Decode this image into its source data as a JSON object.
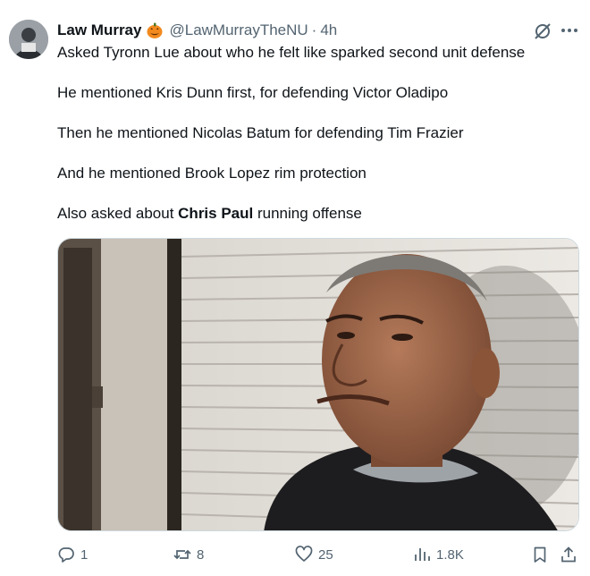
{
  "author": {
    "name": "Law Murray",
    "emoji_icon": "jack-o-lantern-icon",
    "handle": "@LawMurrayTheNU",
    "separator": "·",
    "time": "4h"
  },
  "tweet": {
    "lines": [
      "Asked Tyronn Lue about who he felt like sparked second unit defense",
      "He mentioned Kris Dunn first, for defending Victor Oladipo",
      "Then he mentioned Nicolas Batum for defending Tim Frazier",
      "And he mentioned Brook Lopez rim protection"
    ],
    "last_line_pre": "Also asked about ",
    "last_line_bold": "Chris Paul",
    "last_line_post": " running offense"
  },
  "actions": {
    "replies": "1",
    "reposts": "8",
    "likes": "25",
    "views": "1.8K"
  },
  "colors": {
    "text": "#0f1419",
    "secondary": "#536471",
    "border": "#cfd9de"
  }
}
